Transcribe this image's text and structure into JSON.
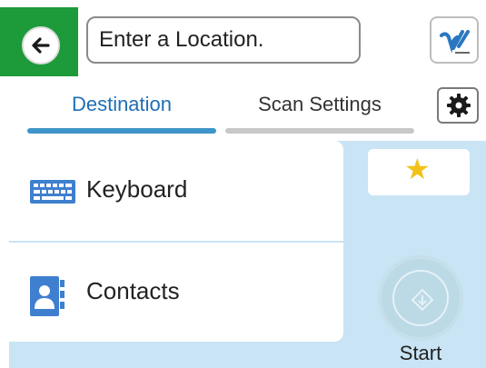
{
  "header": {
    "location_placeholder": "Enter a Location.",
    "back_icon": "arrow-left-icon",
    "app_icon": "scan-app-logo-icon",
    "settings_icon": "gear-icon"
  },
  "tabs": [
    {
      "label": "Destination",
      "active": true
    },
    {
      "label": "Scan Settings",
      "active": false
    }
  ],
  "destinations": [
    {
      "label": "Keyboard",
      "icon": "keyboard-icon"
    },
    {
      "label": "Contacts",
      "icon": "contacts-icon"
    }
  ],
  "favorites": {
    "icon": "star-icon"
  },
  "start": {
    "label": "Start",
    "enabled": false
  },
  "colors": {
    "back_button_bg": "#1d9a3a",
    "active_tab": "#1f6fb5",
    "active_tab_underline": "#3f95c9",
    "content_bg": "#c9e4f4",
    "star": "#f2c21b"
  }
}
